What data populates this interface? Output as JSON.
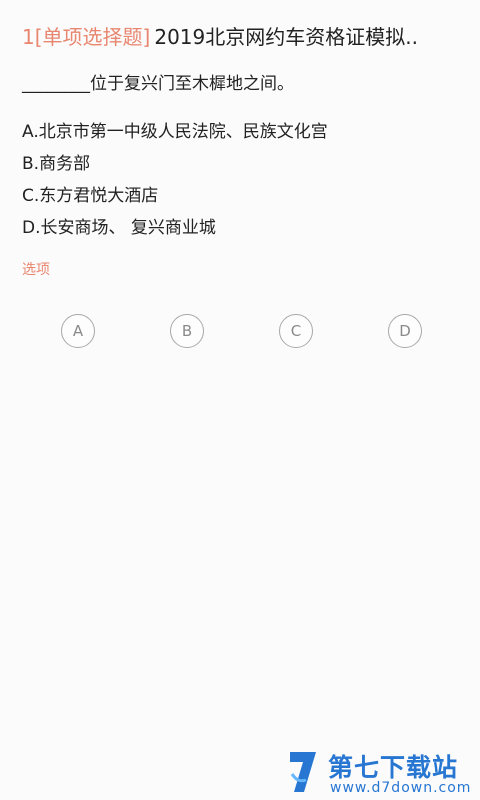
{
  "question": {
    "tag": "1[单项选择题]",
    "title": "2019北京网约车资格证模拟..",
    "stem": "________位于复兴门至木樨地之间。",
    "options": [
      "A.北京市第一中级人民法院、民族文化宫",
      "B.商务部",
      "C.东方君悦大酒店",
      "D.长安商场、 复兴商业城"
    ]
  },
  "answer_section": {
    "label": "选项",
    "choices": [
      "A",
      "B",
      "C",
      "D"
    ]
  },
  "watermark": {
    "brand_cn": "第七下载站",
    "brand_en": "www.d7down.com"
  },
  "colors": {
    "accent": "#e8866f",
    "watermark": "#1b6fd0",
    "choice_border": "#a8a8a8"
  }
}
